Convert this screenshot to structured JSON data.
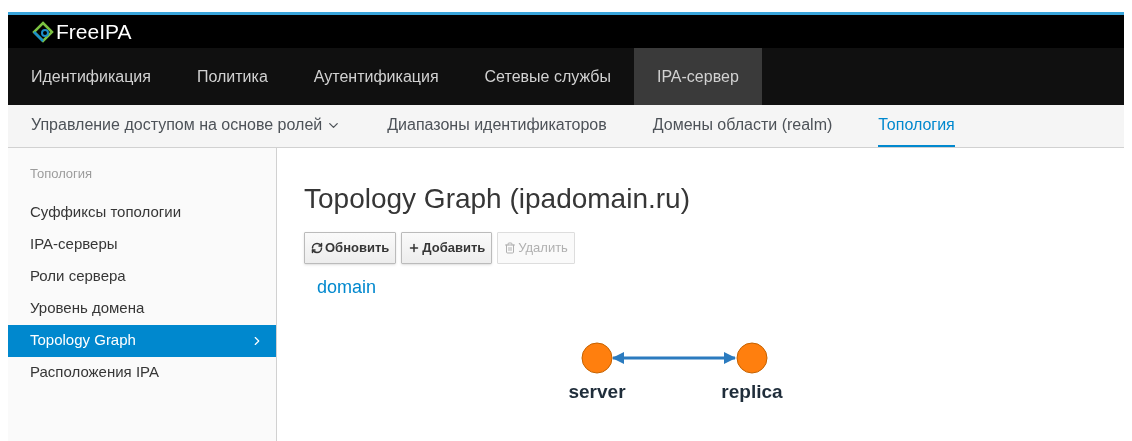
{
  "brand": "FreeIPA",
  "nav": [
    {
      "label": "Идентификация",
      "selected": false
    },
    {
      "label": "Политика",
      "selected": false
    },
    {
      "label": "Аутентификация",
      "selected": false
    },
    {
      "label": "Сетевые службы",
      "selected": false
    },
    {
      "label": "IPA-сервер",
      "selected": true
    }
  ],
  "subnav": [
    {
      "label": "Управление доступом на основе ролей",
      "dropdown": true,
      "selected": false
    },
    {
      "label": "Диапазоны идентификаторов",
      "dropdown": false,
      "selected": false
    },
    {
      "label": "Домены области (realm)",
      "dropdown": false,
      "selected": false
    },
    {
      "label": "Топология",
      "dropdown": false,
      "selected": true
    }
  ],
  "sidebar": {
    "heading": "Топология",
    "items": [
      {
        "label": "Суффиксы топологии",
        "selected": false
      },
      {
        "label": "IPA-серверы",
        "selected": false
      },
      {
        "label": "Роли сервера",
        "selected": false
      },
      {
        "label": "Уровень домена",
        "selected": false
      },
      {
        "label": "Topology Graph",
        "selected": true
      },
      {
        "label": "Расположения IPA",
        "selected": false
      }
    ]
  },
  "page_title": "Topology Graph (ipadomain.ru)",
  "buttons": [
    {
      "label": "Обновить",
      "kind": "refresh",
      "disabled": false
    },
    {
      "label": "Добавить",
      "kind": "add",
      "disabled": false
    },
    {
      "label": "Удалить",
      "kind": "delete",
      "disabled": true
    }
  ],
  "suffix_link": "domain",
  "graph": {
    "nodes": [
      {
        "label": "server"
      },
      {
        "label": "replica"
      }
    ]
  }
}
